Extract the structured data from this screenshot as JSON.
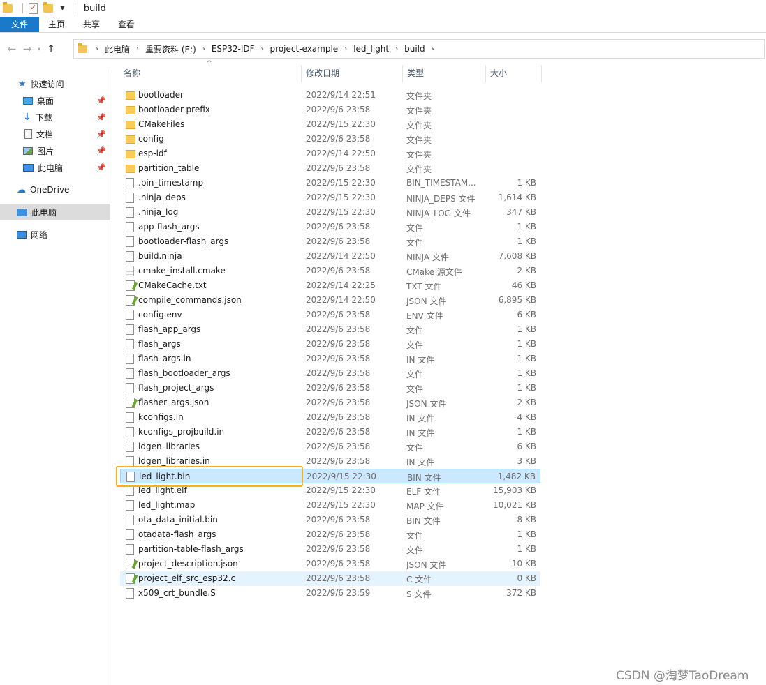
{
  "window": {
    "title": "build"
  },
  "ribbon": {
    "tabs": [
      "文件",
      "主页",
      "共享",
      "查看"
    ]
  },
  "address": {
    "crumbs": [
      "此电脑",
      "重要资料 (E:)",
      "ESP32-IDF",
      "project-example",
      "led_light",
      "build"
    ]
  },
  "nav": {
    "quick_access": "快速访问",
    "items": [
      "桌面",
      "下载",
      "文档",
      "图片",
      "此电脑"
    ],
    "onedrive": "OneDrive",
    "this_pc": "此电脑",
    "network": "网络"
  },
  "columns": {
    "name": "名称",
    "date": "修改日期",
    "type": "类型",
    "size": "大小"
  },
  "files": [
    {
      "name": "bootloader",
      "date": "2022/9/14 22:51",
      "type": "文件夹",
      "size": "",
      "icon": "folder-icon"
    },
    {
      "name": "bootloader-prefix",
      "date": "2022/9/6 23:58",
      "type": "文件夹",
      "size": "",
      "icon": "folder-icon"
    },
    {
      "name": "CMakeFiles",
      "date": "2022/9/15 22:30",
      "type": "文件夹",
      "size": "",
      "icon": "folder-icon"
    },
    {
      "name": "config",
      "date": "2022/9/6 23:58",
      "type": "文件夹",
      "size": "",
      "icon": "folder-icon"
    },
    {
      "name": "esp-idf",
      "date": "2022/9/14 22:50",
      "type": "文件夹",
      "size": "",
      "icon": "folder-icon"
    },
    {
      "name": "partition_table",
      "date": "2022/9/6 23:58",
      "type": "文件夹",
      "size": "",
      "icon": "folder-icon"
    },
    {
      "name": ".bin_timestamp",
      "date": "2022/9/15 22:30",
      "type": "BIN_TIMESTAM...",
      "size": "1 KB",
      "icon": "file-icon"
    },
    {
      "name": ".ninja_deps",
      "date": "2022/9/15 22:30",
      "type": "NINJA_DEPS 文件",
      "size": "1,614 KB",
      "icon": "file-icon"
    },
    {
      "name": ".ninja_log",
      "date": "2022/9/15 22:30",
      "type": "NINJA_LOG 文件",
      "size": "347 KB",
      "icon": "file-icon"
    },
    {
      "name": "app-flash_args",
      "date": "2022/9/6 23:58",
      "type": "文件",
      "size": "1 KB",
      "icon": "file-icon"
    },
    {
      "name": "bootloader-flash_args",
      "date": "2022/9/6 23:58",
      "type": "文件",
      "size": "1 KB",
      "icon": "file-icon"
    },
    {
      "name": "build.ninja",
      "date": "2022/9/14 22:50",
      "type": "NINJA 文件",
      "size": "7,608 KB",
      "icon": "file-icon"
    },
    {
      "name": "cmake_install.cmake",
      "date": "2022/9/6 23:58",
      "type": "CMake 源文件",
      "size": "2 KB",
      "icon": "cmake-file-icon"
    },
    {
      "name": "CMakeCache.txt",
      "date": "2022/9/14 22:25",
      "type": "TXT 文件",
      "size": "46 KB",
      "icon": "text-file-icon"
    },
    {
      "name": "compile_commands.json",
      "date": "2022/9/14 22:50",
      "type": "JSON 文件",
      "size": "6,895 KB",
      "icon": "text-file-icon"
    },
    {
      "name": "config.env",
      "date": "2022/9/6 23:58",
      "type": "ENV 文件",
      "size": "6 KB",
      "icon": "file-icon"
    },
    {
      "name": "flash_app_args",
      "date": "2022/9/6 23:58",
      "type": "文件",
      "size": "1 KB",
      "icon": "file-icon"
    },
    {
      "name": "flash_args",
      "date": "2022/9/6 23:58",
      "type": "文件",
      "size": "1 KB",
      "icon": "file-icon"
    },
    {
      "name": "flash_args.in",
      "date": "2022/9/6 23:58",
      "type": "IN 文件",
      "size": "1 KB",
      "icon": "file-icon"
    },
    {
      "name": "flash_bootloader_args",
      "date": "2022/9/6 23:58",
      "type": "文件",
      "size": "1 KB",
      "icon": "file-icon"
    },
    {
      "name": "flash_project_args",
      "date": "2022/9/6 23:58",
      "type": "文件",
      "size": "1 KB",
      "icon": "file-icon"
    },
    {
      "name": "flasher_args.json",
      "date": "2022/9/6 23:58",
      "type": "JSON 文件",
      "size": "2 KB",
      "icon": "text-file-icon"
    },
    {
      "name": "kconfigs.in",
      "date": "2022/9/6 23:58",
      "type": "IN 文件",
      "size": "4 KB",
      "icon": "file-icon"
    },
    {
      "name": "kconfigs_projbuild.in",
      "date": "2022/9/6 23:58",
      "type": "IN 文件",
      "size": "1 KB",
      "icon": "file-icon"
    },
    {
      "name": "ldgen_libraries",
      "date": "2022/9/6 23:58",
      "type": "文件",
      "size": "6 KB",
      "icon": "file-icon"
    },
    {
      "name": "ldgen_libraries.in",
      "date": "2022/9/6 23:58",
      "type": "IN 文件",
      "size": "3 KB",
      "icon": "file-icon"
    },
    {
      "name": "led_light.bin",
      "date": "2022/9/15 22:30",
      "type": "BIN 文件",
      "size": "1,482 KB",
      "icon": "file-icon",
      "selected": true
    },
    {
      "name": "led_light.elf",
      "date": "2022/9/15 22:30",
      "type": "ELF 文件",
      "size": "15,903 KB",
      "icon": "file-icon"
    },
    {
      "name": "led_light.map",
      "date": "2022/9/15 22:30",
      "type": "MAP 文件",
      "size": "10,021 KB",
      "icon": "file-icon"
    },
    {
      "name": "ota_data_initial.bin",
      "date": "2022/9/6 23:58",
      "type": "BIN 文件",
      "size": "8 KB",
      "icon": "file-icon"
    },
    {
      "name": "otadata-flash_args",
      "date": "2022/9/6 23:58",
      "type": "文件",
      "size": "1 KB",
      "icon": "file-icon"
    },
    {
      "name": "partition-table-flash_args",
      "date": "2022/9/6 23:58",
      "type": "文件",
      "size": "1 KB",
      "icon": "file-icon"
    },
    {
      "name": "project_description.json",
      "date": "2022/9/6 23:58",
      "type": "JSON 文件",
      "size": "10 KB",
      "icon": "text-file-icon"
    },
    {
      "name": "project_elf_src_esp32.c",
      "date": "2022/9/6 23:58",
      "type": "C 文件",
      "size": "0 KB",
      "icon": "text-file-icon",
      "hovered": true
    },
    {
      "name": "x509_crt_bundle.S",
      "date": "2022/9/6 23:59",
      "type": "S 文件",
      "size": "372 KB",
      "icon": "file-icon"
    }
  ],
  "watermark": "CSDN @淘梦TaoDream",
  "colors": {
    "ribbon_file_tab": "#1979ca",
    "selection": "#cce8ff",
    "highlight_box": "#f6b11b"
  }
}
